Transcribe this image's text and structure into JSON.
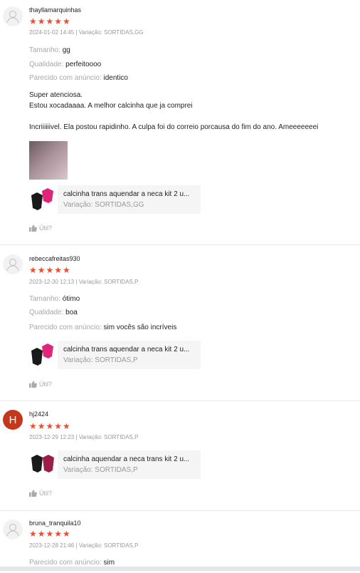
{
  "reviews": [
    {
      "username": "thayllamarquinhas",
      "stars": "★★★★★",
      "meta": "2024-01-02 14:45 | Variação: SORTIDAS,GG",
      "attrs": [
        {
          "label": "Tamanho:",
          "value": "gg"
        },
        {
          "label": "Qualidade:",
          "value": "perfeitoooo"
        },
        {
          "label": "Parecido com anúncio:",
          "value": "identico"
        }
      ],
      "text": "Super atenciosa.\nEstou xocadaaaa. A melhor calcinha que ja comprei\n\nIncriiiiiivel. Ela postou rapidinho. A culpa foi do correio porcausa do fim do ano. Ameeeeeeei",
      "product_name": "calcinha trans aquendar a neca kit 2 u...",
      "product_variation": "Variação: SORTIDAS,GG",
      "helpful": "Útil?"
    },
    {
      "username": "rebeccafreitas930",
      "stars": "★★★★★",
      "meta": "2023-12-30 12:13 | Variação: SORTIDAS,P",
      "attrs": [
        {
          "label": "Tamanho:",
          "value": "ótimo"
        },
        {
          "label": "Qualidade:",
          "value": "boa"
        },
        {
          "label": "Parecido com anúncio:",
          "value": "sim vocês são incríveis"
        }
      ],
      "product_name": "calcinha trans aquendar a neca kit 2 u...",
      "product_variation": "Variação: SORTIDAS,P",
      "helpful": "Útil?"
    },
    {
      "avatar_letter": "H",
      "username": "hj2424",
      "stars": "★★★★★",
      "meta": "2023-12-29 12:23 | Variação: SORTIDAS,P",
      "product_name": "calcinha aquendar a neca trans kit 2 u...",
      "product_variation": "Variação: SORTIDAS,P",
      "helpful": "Útil?"
    },
    {
      "username": "bruna_tranquila10",
      "stars": "★★★★★",
      "meta": "2023-12-28 21:46 | Variação: SORTIDAS,P",
      "attrs": [
        {
          "label": "Parecido com anúncio:",
          "value": "sim"
        }
      ]
    }
  ],
  "colors": {
    "star": "#ee4d2d",
    "avatar_h": "#c4371b"
  },
  "icons": {
    "avatar": "user-silhouette-icon",
    "helpful": "thumbs-up-icon"
  }
}
